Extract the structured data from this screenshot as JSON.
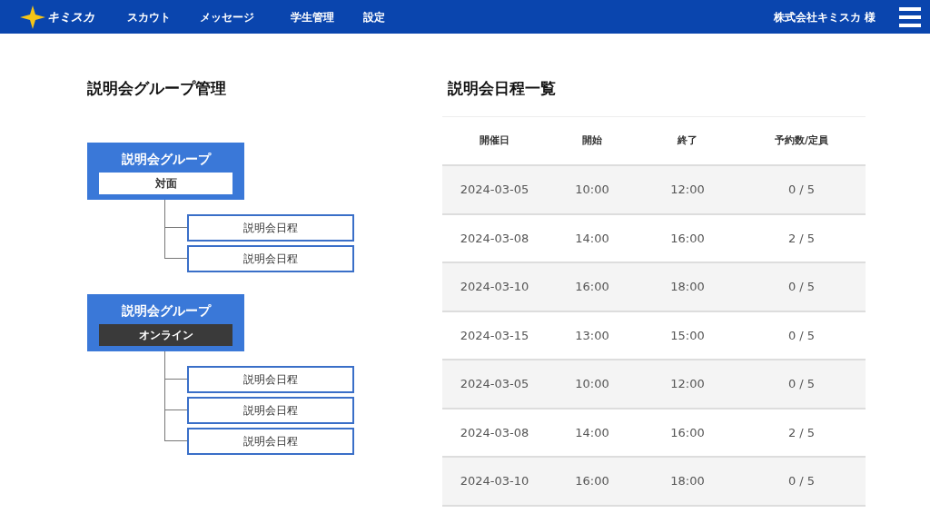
{
  "header": {
    "logo": "キミスカ",
    "nav": [
      "スカウト",
      "メッセージ",
      "学生管理",
      "設定"
    ],
    "company": "株式会社キミスカ 様"
  },
  "groups_panel": {
    "title": "説明会グループ管理",
    "groups": [
      {
        "label": "説明会グループ",
        "tag": {
          "text": "対面",
          "kind": "light"
        },
        "children": [
          "説明会日程",
          "説明会日程"
        ]
      },
      {
        "label": "説明会グループ",
        "tag": {
          "text": "オンライン",
          "kind": "dark"
        },
        "children": [
          "説明会日程",
          "説明会日程",
          "説明会日程"
        ]
      }
    ]
  },
  "schedule": {
    "title": "説明会日程一覧",
    "columns": [
      "開催日",
      "開始",
      "終了",
      "予約数/定員"
    ],
    "rows": [
      [
        "2024-03-05",
        "10:00",
        "12:00",
        "0 / 5"
      ],
      [
        "2024-03-08",
        "14:00",
        "16:00",
        "2 / 5"
      ],
      [
        "2024-03-10",
        "16:00",
        "18:00",
        "0 / 5"
      ],
      [
        "2024-03-15",
        "13:00",
        "15:00",
        "0 / 5"
      ],
      [
        "2024-03-05",
        "10:00",
        "12:00",
        "0 / 5"
      ],
      [
        "2024-03-08",
        "14:00",
        "16:00",
        "2 / 5"
      ],
      [
        "2024-03-10",
        "16:00",
        "18:00",
        "0 / 5"
      ]
    ]
  }
}
